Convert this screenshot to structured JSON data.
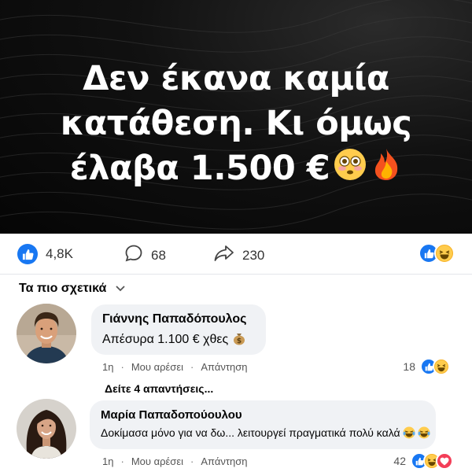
{
  "banner": {
    "headline_lines": [
      "Δεν έκανα καμία",
      "κατάθεση. Κι όμως",
      "έλαβα 1.500 €"
    ],
    "emojis": [
      "flushed-face-emoji",
      "fire-emoji"
    ]
  },
  "stats": {
    "likes": "4,8K",
    "comments": "68",
    "shares": "230",
    "reactions": [
      "like-reaction",
      "haha-reaction"
    ]
  },
  "filter": {
    "label": "Τα πιο σχετικά",
    "icon": "chevron-down-icon"
  },
  "comments": [
    {
      "author": "Γιάννης Παπαδόπουλος",
      "text": "Απέσυρα 1.100 € χθες",
      "emoji": "money-bag-emoji",
      "time": "1η",
      "like_label": "Μου αρέσει",
      "reply_label": "Απάντηση",
      "reaction_count": "18",
      "reactions": [
        "like-reaction",
        "haha-reaction"
      ]
    },
    {
      "author": "Μαρία Παπαδοπούουλου",
      "text": "Δοκίμασα μόνο για να δω... λειτουργεί πραγματικά πολύ καλά",
      "emoji": "laughing-tears-emoji",
      "time": "1η",
      "like_label": "Μου αρέσει",
      "reply_label": "Απάντηση",
      "reaction_count": "42",
      "reactions": [
        "like-reaction",
        "haha-reaction",
        "love-reaction"
      ]
    }
  ],
  "view_replies": "Δείτε 4 απαντήσεις...",
  "colors": {
    "facebook_blue": "#1877f2",
    "haha_yellow": "#f7b125",
    "love_red": "#f33e58",
    "bubble_gray": "#f0f2f5",
    "banner_black": "#0b0b0b"
  }
}
